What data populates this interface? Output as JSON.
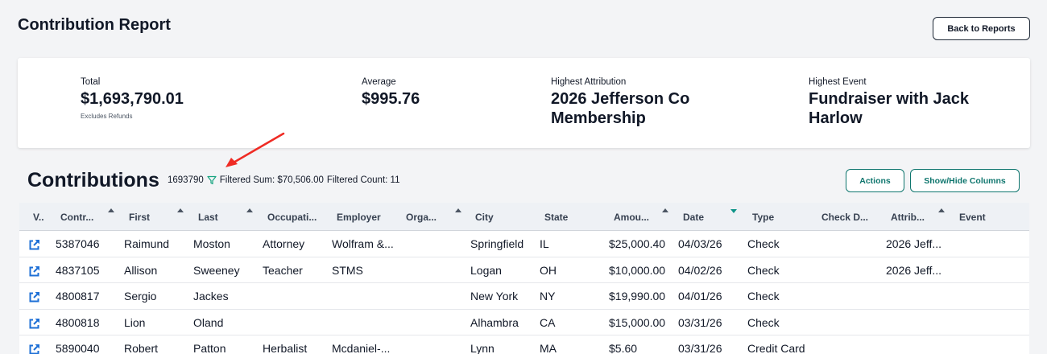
{
  "header": {
    "title": "Contribution Report",
    "back_label": "Back to Reports"
  },
  "summary": {
    "total_label": "Total",
    "total_value": "$1,693,790.01",
    "total_note": "Excludes Refunds",
    "average_label": "Average",
    "average_value": "$995.76",
    "attribution_label": "Highest Attribution",
    "attribution_line1": "2026 Jefferson Co",
    "attribution_line2": "Membership",
    "event_label": "Highest Event",
    "event_line1": "Fundraiser with Jack",
    "event_line2": "Harlow"
  },
  "contributions": {
    "title": "Contributions",
    "count": "1693790",
    "filtered_sum": "Filtered Sum: $70,506.00",
    "filtered_count": "Filtered Count: 11",
    "actions_label": "Actions",
    "columns_label": "Show/Hide Columns"
  },
  "colors": {
    "accent": "#0f766e",
    "link": "#1d6fd6",
    "annotation_arrow": "#ef2b24"
  },
  "icons": {
    "row_link": "external-link-icon",
    "filter": "filter-icon",
    "sort": "sort-arrow-icon"
  },
  "table": {
    "columns": [
      "V..",
      "Contr...",
      "First",
      "Last",
      "Occupati...",
      "Employer",
      "Orga...",
      "City",
      "State",
      "Amou...",
      "Date",
      "Type",
      "Check D...",
      "Attrib...",
      "Event"
    ],
    "active_sort": "Date",
    "rows": [
      [
        "",
        "5387046",
        "Raimund",
        "Moston",
        "Attorney",
        "Wolfram &...",
        "",
        "Springfield",
        "IL",
        "$25,000.40",
        "04/03/26",
        "Check",
        "",
        "2026 Jeff...",
        ""
      ],
      [
        "",
        "4837105",
        "Allison",
        "Sweeney",
        "Teacher",
        "STMS",
        "",
        "Logan",
        "OH",
        "$10,000.00",
        "04/02/26",
        "Check",
        "",
        "2026 Jeff...",
        ""
      ],
      [
        "",
        "4800817",
        "Sergio",
        "Jackes",
        "",
        "",
        "",
        "New York",
        "NY",
        "$19,990.00",
        "04/01/26",
        "Check",
        "",
        "",
        ""
      ],
      [
        "",
        "4800818",
        "Lion",
        "Oland",
        "",
        "",
        "",
        "Alhambra",
        "CA",
        "$15,000.00",
        "03/31/26",
        "Check",
        "",
        "",
        ""
      ],
      [
        "",
        "5890040",
        "Robert",
        "Patton",
        "Herbalist",
        "Mcdaniel-...",
        "",
        "Lynn",
        "MA",
        "$5.60",
        "03/31/26",
        "Credit Card",
        "",
        "",
        ""
      ]
    ]
  }
}
